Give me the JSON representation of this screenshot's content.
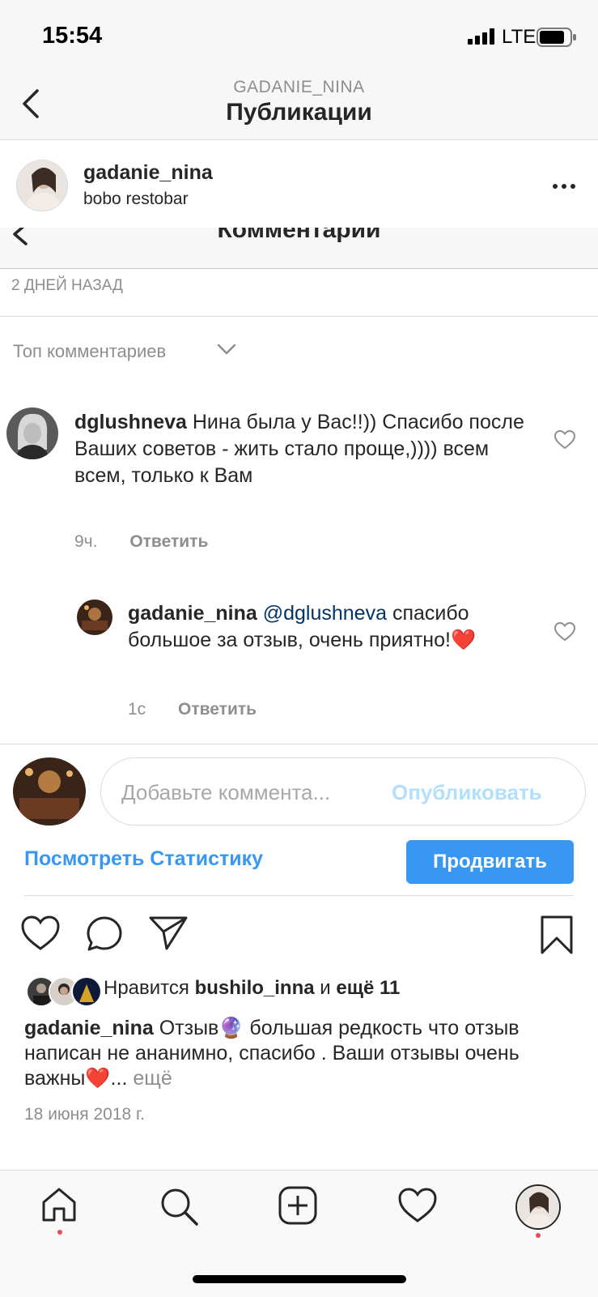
{
  "status_bar": {
    "time": "15:54",
    "network": "LTE"
  },
  "nav": {
    "subtitle": "GADANIE_NINA",
    "title": "Публикации"
  },
  "post_header": {
    "username": "gadanie_nina",
    "location": "bobo restobar"
  },
  "comments": {
    "title": "Комментарии",
    "days_ago": "2 ДНЕЙ НАЗАД",
    "sort_label": "Топ комментариев",
    "items": [
      {
        "username": "dglushneva",
        "text": "Нина была у Вас!!)) Спасибо  после Ваших советов - жить стало проще,)))) всем всем, только к Вам",
        "time": "9ч.",
        "reply_label": "Ответить"
      },
      {
        "username": "gadanie_nina",
        "mention": "@dglushneva",
        "text": "спасибо большое за отзыв, очень приятно!",
        "emoji": "❤️",
        "time": "1с",
        "reply_label": "Ответить"
      }
    ],
    "input_placeholder": "Добавьте коммента...",
    "publish_label": "Опубликовать"
  },
  "actions": {
    "stats_label": "Посмотреть Статистику",
    "promote_label": "Продвигать"
  },
  "likes": {
    "prefix": "Нравится",
    "user": "bushilo_inna",
    "middle": "и",
    "more": "ещё 11"
  },
  "caption": {
    "username": "gadanie_nina",
    "text_before_emoji": "Отзыв",
    "emoji1": "🔮",
    "text_after_emoji": " большая редкость что отзыв написан не ананимно, спасибо . Ваши отзывы очень важны",
    "emoji2": "❤️",
    "ellipsis": "...",
    "more_label": "ещё"
  },
  "date": "18 июня 2018 г.",
  "icons": [
    "back-icon",
    "more-icon",
    "heart-icon",
    "comment-icon",
    "share-icon",
    "bookmark-icon",
    "home-icon",
    "search-icon",
    "add-icon",
    "activity-icon",
    "profile-icon"
  ],
  "colors": {
    "accent": "#3897f0",
    "mention": "#003569",
    "notification_dot": "#ed4956"
  }
}
